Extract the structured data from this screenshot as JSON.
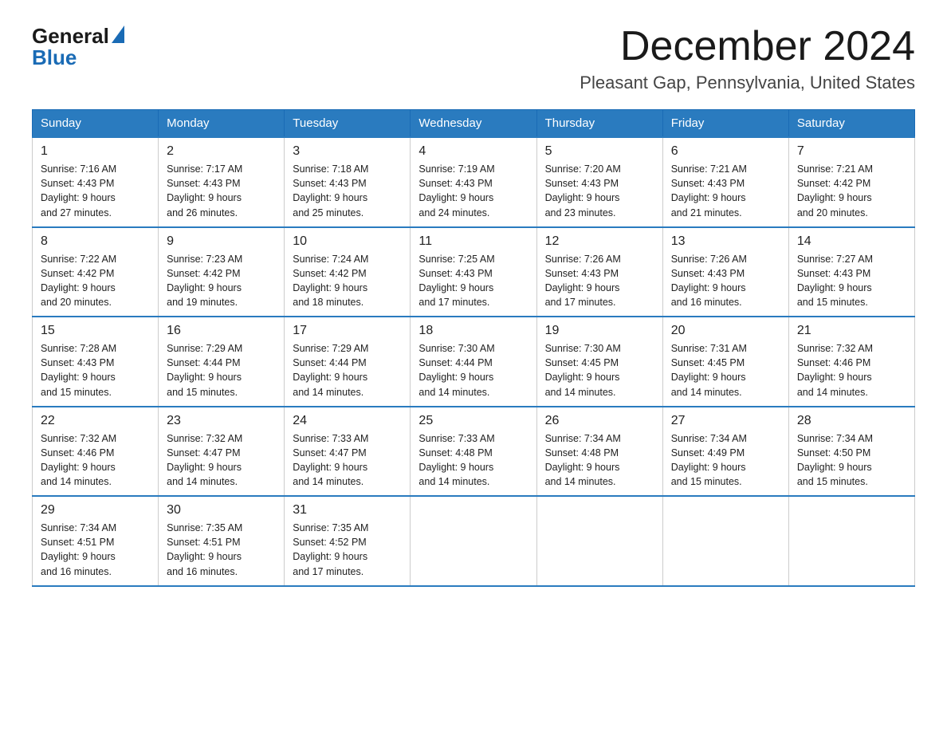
{
  "header": {
    "logo_general": "General",
    "logo_blue": "Blue",
    "title": "December 2024",
    "subtitle": "Pleasant Gap, Pennsylvania, United States"
  },
  "days_of_week": [
    "Sunday",
    "Monday",
    "Tuesday",
    "Wednesday",
    "Thursday",
    "Friday",
    "Saturday"
  ],
  "weeks": [
    [
      {
        "day": "1",
        "sunrise": "7:16 AM",
        "sunset": "4:43 PM",
        "daylight": "9 hours and 27 minutes."
      },
      {
        "day": "2",
        "sunrise": "7:17 AM",
        "sunset": "4:43 PM",
        "daylight": "9 hours and 26 minutes."
      },
      {
        "day": "3",
        "sunrise": "7:18 AM",
        "sunset": "4:43 PM",
        "daylight": "9 hours and 25 minutes."
      },
      {
        "day": "4",
        "sunrise": "7:19 AM",
        "sunset": "4:43 PM",
        "daylight": "9 hours and 24 minutes."
      },
      {
        "day": "5",
        "sunrise": "7:20 AM",
        "sunset": "4:43 PM",
        "daylight": "9 hours and 23 minutes."
      },
      {
        "day": "6",
        "sunrise": "7:21 AM",
        "sunset": "4:43 PM",
        "daylight": "9 hours and 21 minutes."
      },
      {
        "day": "7",
        "sunrise": "7:21 AM",
        "sunset": "4:42 PM",
        "daylight": "9 hours and 20 minutes."
      }
    ],
    [
      {
        "day": "8",
        "sunrise": "7:22 AM",
        "sunset": "4:42 PM",
        "daylight": "9 hours and 20 minutes."
      },
      {
        "day": "9",
        "sunrise": "7:23 AM",
        "sunset": "4:42 PM",
        "daylight": "9 hours and 19 minutes."
      },
      {
        "day": "10",
        "sunrise": "7:24 AM",
        "sunset": "4:42 PM",
        "daylight": "9 hours and 18 minutes."
      },
      {
        "day": "11",
        "sunrise": "7:25 AM",
        "sunset": "4:43 PM",
        "daylight": "9 hours and 17 minutes."
      },
      {
        "day": "12",
        "sunrise": "7:26 AM",
        "sunset": "4:43 PM",
        "daylight": "9 hours and 17 minutes."
      },
      {
        "day": "13",
        "sunrise": "7:26 AM",
        "sunset": "4:43 PM",
        "daylight": "9 hours and 16 minutes."
      },
      {
        "day": "14",
        "sunrise": "7:27 AM",
        "sunset": "4:43 PM",
        "daylight": "9 hours and 15 minutes."
      }
    ],
    [
      {
        "day": "15",
        "sunrise": "7:28 AM",
        "sunset": "4:43 PM",
        "daylight": "9 hours and 15 minutes."
      },
      {
        "day": "16",
        "sunrise": "7:29 AM",
        "sunset": "4:44 PM",
        "daylight": "9 hours and 15 minutes."
      },
      {
        "day": "17",
        "sunrise": "7:29 AM",
        "sunset": "4:44 PM",
        "daylight": "9 hours and 14 minutes."
      },
      {
        "day": "18",
        "sunrise": "7:30 AM",
        "sunset": "4:44 PM",
        "daylight": "9 hours and 14 minutes."
      },
      {
        "day": "19",
        "sunrise": "7:30 AM",
        "sunset": "4:45 PM",
        "daylight": "9 hours and 14 minutes."
      },
      {
        "day": "20",
        "sunrise": "7:31 AM",
        "sunset": "4:45 PM",
        "daylight": "9 hours and 14 minutes."
      },
      {
        "day": "21",
        "sunrise": "7:32 AM",
        "sunset": "4:46 PM",
        "daylight": "9 hours and 14 minutes."
      }
    ],
    [
      {
        "day": "22",
        "sunrise": "7:32 AM",
        "sunset": "4:46 PM",
        "daylight": "9 hours and 14 minutes."
      },
      {
        "day": "23",
        "sunrise": "7:32 AM",
        "sunset": "4:47 PM",
        "daylight": "9 hours and 14 minutes."
      },
      {
        "day": "24",
        "sunrise": "7:33 AM",
        "sunset": "4:47 PM",
        "daylight": "9 hours and 14 minutes."
      },
      {
        "day": "25",
        "sunrise": "7:33 AM",
        "sunset": "4:48 PM",
        "daylight": "9 hours and 14 minutes."
      },
      {
        "day": "26",
        "sunrise": "7:34 AM",
        "sunset": "4:48 PM",
        "daylight": "9 hours and 14 minutes."
      },
      {
        "day": "27",
        "sunrise": "7:34 AM",
        "sunset": "4:49 PM",
        "daylight": "9 hours and 15 minutes."
      },
      {
        "day": "28",
        "sunrise": "7:34 AM",
        "sunset": "4:50 PM",
        "daylight": "9 hours and 15 minutes."
      }
    ],
    [
      {
        "day": "29",
        "sunrise": "7:34 AM",
        "sunset": "4:51 PM",
        "daylight": "9 hours and 16 minutes."
      },
      {
        "day": "30",
        "sunrise": "7:35 AM",
        "sunset": "4:51 PM",
        "daylight": "9 hours and 16 minutes."
      },
      {
        "day": "31",
        "sunrise": "7:35 AM",
        "sunset": "4:52 PM",
        "daylight": "9 hours and 17 minutes."
      },
      null,
      null,
      null,
      null
    ]
  ],
  "labels": {
    "sunrise": "Sunrise:",
    "sunset": "Sunset:",
    "daylight": "Daylight:"
  }
}
